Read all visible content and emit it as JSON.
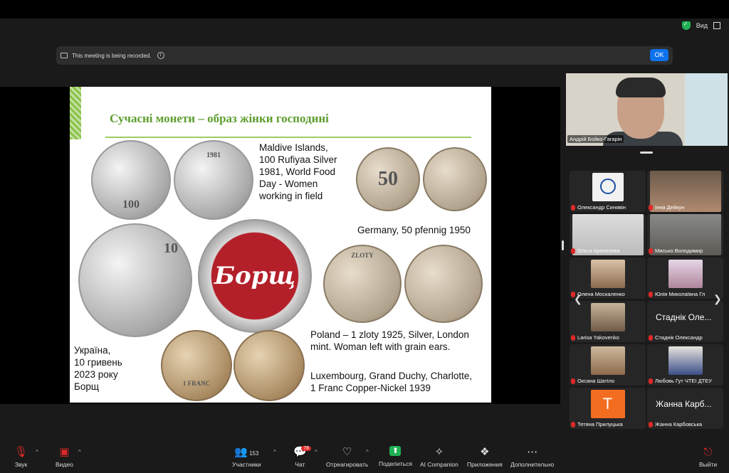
{
  "top": {
    "view_label": "Вид"
  },
  "banner": {
    "text": "This meeting is being recorded.",
    "ok": "OK"
  },
  "slide": {
    "title": "Сучасні монети – образ жінки господині",
    "captions": {
      "maldives": [
        "Maldive Islands,",
        "100 Rufiyaa Silver",
        "1981, World Food",
        "Day - Women",
        "working in field"
      ],
      "germany": "Germany, 50 pfennig 1950",
      "ukraine": [
        "Україна,",
        "10 гривень",
        "2023 року",
        "Борщ"
      ],
      "poland": [
        "Poland – 1 zloty 1925, Silver, London",
        "mint. Woman left with grain ears."
      ],
      "luxembourg": [
        "Luxembourg, Grand Duchy, Charlotte,",
        "1 Franc Copper-Nickel 1939"
      ]
    },
    "coin_texts": {
      "maldives_value": "100",
      "maldives_year": "1981",
      "ger_value": "50",
      "ukr_value": "10",
      "borsch": "Борщ",
      "pol": "ZLOTY",
      "lux": "1 FRANC"
    }
  },
  "self_view": {
    "name": "Андрій Бойко-Гагарін"
  },
  "participants": [
    {
      "name": "Олександр Синявін",
      "type": "logo"
    },
    {
      "name": "Інна Дейкун",
      "type": "video"
    },
    {
      "name": "Ольга Крехелева",
      "type": "video"
    },
    {
      "name": "Мисько Володимир",
      "type": "video"
    },
    {
      "name": "Олена Москаленко",
      "type": "photo"
    },
    {
      "name": "Юлія Миколаївна Гл",
      "type": "photo"
    },
    {
      "name": "Larisa Yakovenko",
      "type": "video"
    },
    {
      "name": "Стаднік Олександр",
      "big": "Стаднік Оле...",
      "type": "text"
    },
    {
      "name": "Оксана Шатіло",
      "type": "photo"
    },
    {
      "name": "Любовь Гут ЧТЕІ ДТЕУ",
      "type": "photo"
    },
    {
      "name": "Тетяна Прилуцька",
      "initial": "Т",
      "type": "initial"
    },
    {
      "name": "Жанна Карбовська",
      "big": "Жанна Карб...",
      "type": "text"
    }
  ],
  "toolbar": {
    "sound": "Звук",
    "video": "Видео",
    "participants": "Участники",
    "participants_count": "153",
    "chat": "Чат",
    "chat_badge": "78",
    "react": "Отреагировать",
    "share": "Поделиться",
    "ai": "AI Companion",
    "apps": "Приложения",
    "more": "Дополнительно",
    "leave": "Выйти"
  },
  "colors": {
    "accent": "#0e72ed",
    "green": "#1fb155",
    "slide_title": "#5d9e2e",
    "muted": "#e02828"
  }
}
